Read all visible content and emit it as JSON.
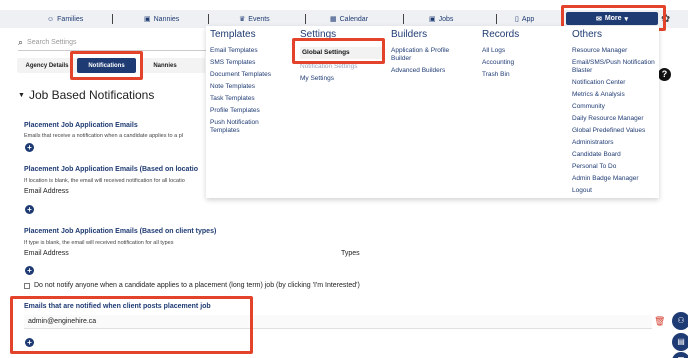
{
  "topnav": {
    "items": [
      {
        "label": "Families",
        "icon": "user-circle-icon"
      },
      {
        "label": "Nannies",
        "icon": "briefcase-icon"
      },
      {
        "label": "Events",
        "icon": "trophy-icon"
      },
      {
        "label": "Calendar",
        "icon": "calendar-icon"
      },
      {
        "label": "Jobs",
        "icon": "briefcase-icon"
      },
      {
        "label": "App",
        "icon": "phone-icon"
      }
    ],
    "more_label": "More",
    "accent": "#1f3b73"
  },
  "search": {
    "placeholder": "Search Settings"
  },
  "tabs": [
    {
      "label": "Agency Details"
    },
    {
      "label": "Notifications",
      "active": true
    },
    {
      "label": "Nannies"
    }
  ],
  "section": {
    "title": "Job Based Notifications",
    "blocks": [
      {
        "heading": "Placement Job Application Emails",
        "note": "Emails that receive a notification when a candidate applies to a pl"
      },
      {
        "heading": "Placement Job Application Emails (Based on locatio",
        "note": "If location is blank, the email will received notification for all locatio",
        "field_label": "Email Address"
      },
      {
        "heading": "Placement Job Application Emails (Based on client types)",
        "note": "If type is blank, the email will received notification for all types",
        "field_label": "Email Address",
        "field_label_2": "Types"
      }
    ],
    "checkbox_label": "Do not notify anyone when a candidate applies to a placement (long term) job (by clicking 'I'm Interested')",
    "client_post": {
      "heading": "Emails that are notified when client posts placement job",
      "email_value": "admin@enginehire.ca"
    }
  },
  "mega_menu": {
    "templates": {
      "heading": "Templates",
      "links": [
        "Email Templates",
        "SMS Templates",
        "Document Templates",
        "Note Templates",
        "Task Templates",
        "Profile Templates",
        "Push Notification Templates"
      ]
    },
    "settings": {
      "heading": "Settings",
      "links": [
        "Global Settings",
        "Notification Settings",
        "My Settings"
      ]
    },
    "builders": {
      "heading": "Builders",
      "links": [
        "Application & Profile Builder",
        "Advanced Builders"
      ]
    },
    "records": {
      "heading": "Records",
      "links": [
        "All Logs",
        "Accounting",
        "Trash Bin"
      ]
    },
    "others": {
      "heading": "Others",
      "links": [
        "Resource Manager",
        "Email/SMS/Push Notification Blaster",
        "Notification Center",
        "Metrics & Analysis",
        "Community",
        "Daily Resource Manager",
        "Global Predefined Values",
        "Administrators",
        "Candidate Board",
        "Personal To Do",
        "Admin Badge Manager",
        "Logout"
      ]
    }
  },
  "colors": {
    "highlight": "#e2432a",
    "link": "#1f3b73",
    "danger": "#d23a2b"
  }
}
